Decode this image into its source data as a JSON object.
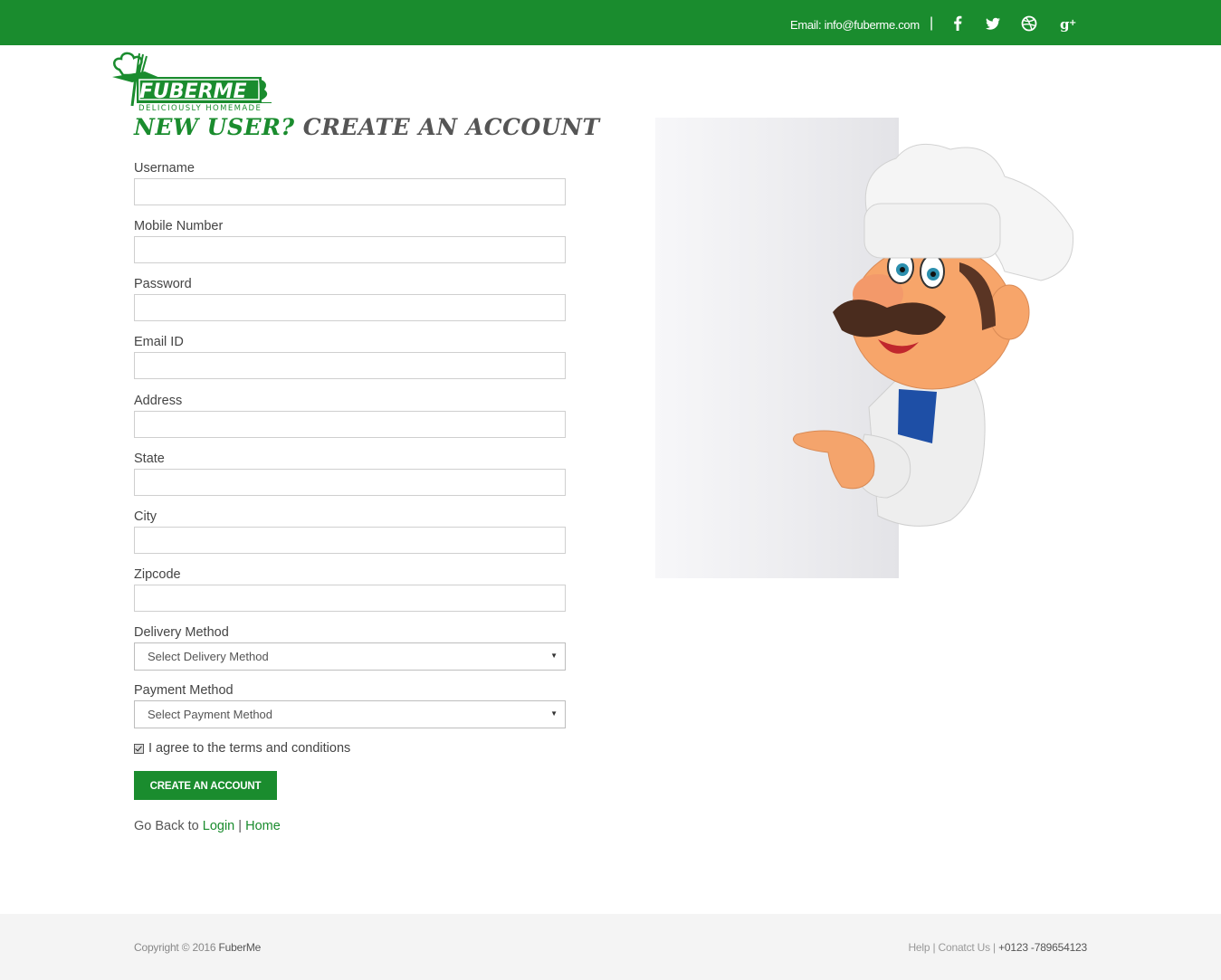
{
  "topbar": {
    "email": "Email: info@fuberme.com",
    "separator": "|",
    "social_icons": [
      "facebook-icon",
      "twitter-icon",
      "dribbble-icon",
      "google-plus-icon"
    ]
  },
  "brand": {
    "logo_text": "FUBERME",
    "tagline": "DELICIOUSLY HOMEMADE",
    "primary_color": "#1a8c2e"
  },
  "heading": {
    "part1": "NEW USER?",
    "part2": "CREATE AN ACCOUNT"
  },
  "form": {
    "username_label": "Username",
    "mobile_label": "Mobile Number",
    "password_label": "Password",
    "email_label": "Email ID",
    "address_label": "Address",
    "state_label": "State",
    "city_label": "City",
    "zipcode_label": "Zipcode",
    "delivery_label": "Delivery Method",
    "delivery_value": "Select Delivery Method",
    "payment_label": "Payment Method",
    "payment_value": "Select Payment Method",
    "agree_text": "I agree to the terms and conditions",
    "agree_checked": true,
    "submit_label": "CREATE AN ACCOUNT"
  },
  "goback": {
    "prefix": "Go Back to",
    "login": "Login",
    "sep": "|",
    "home": "Home"
  },
  "footer": {
    "copyright": "Copyright © 2016",
    "brand": "FuberMe",
    "help": "Help",
    "contact": "Conatct Us",
    "phone": "+0123 -789654123"
  }
}
